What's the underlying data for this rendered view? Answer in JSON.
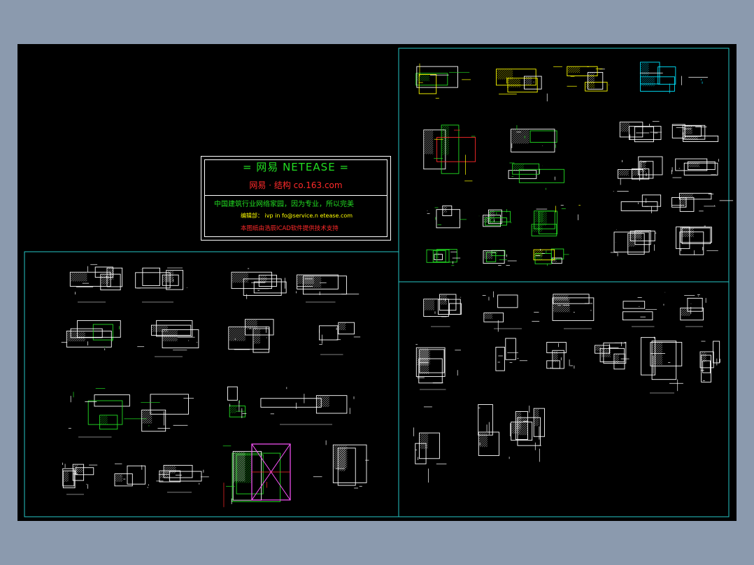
{
  "colors": {
    "background": "#8b9aae",
    "canvas": "#000000",
    "frame": "#26c6c6",
    "line": "#ffffff",
    "green": "#22dd22",
    "yellow": "#ffff00",
    "cyan": "#00e5ff",
    "magenta": "#ff55ff",
    "red": "#ff2a2a"
  },
  "title_block": {
    "heading": "= 网易 NETEASE =",
    "subtitle": "网易 · 结构  co.163.com",
    "line1": "中国建筑行业网络家园，因为专业，所以完美",
    "line2": "编辑部：  ivp in fo@service.n etease.com",
    "line3": "本图纸由浩辰ICAD软件提供技术支持"
  }
}
